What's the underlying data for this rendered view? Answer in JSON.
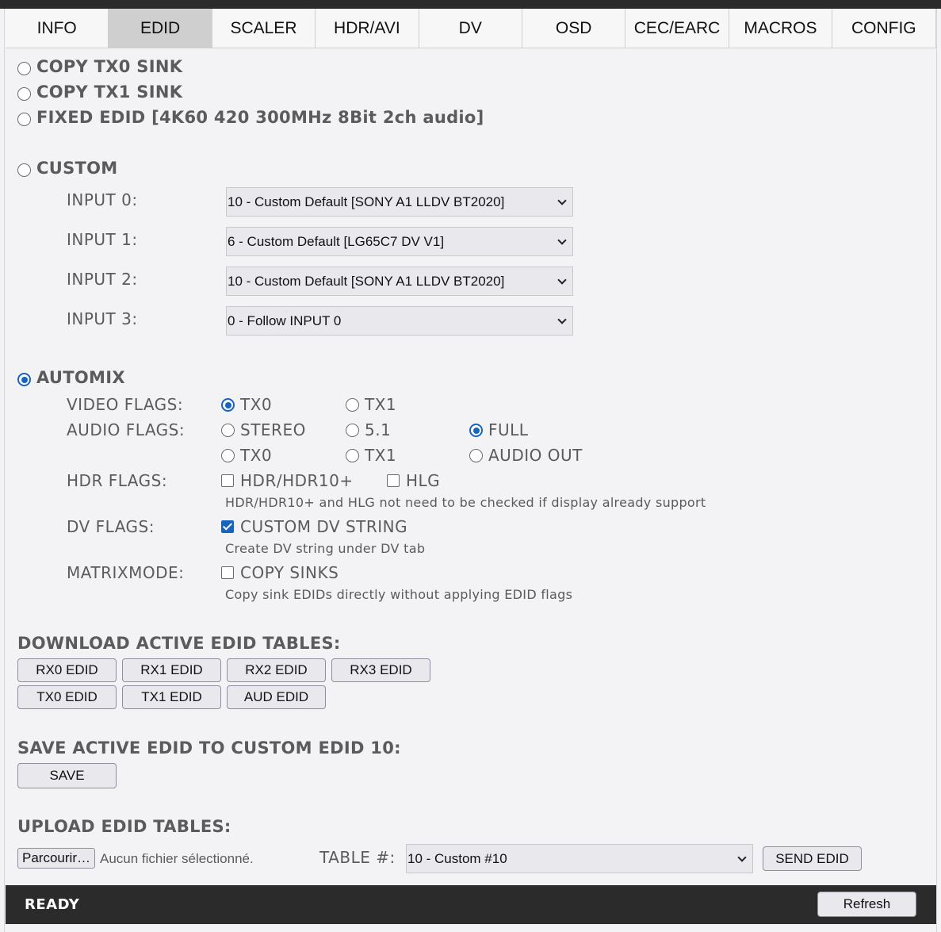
{
  "tabs": [
    "INFO",
    "EDID",
    "SCALER",
    "HDR/AVI",
    "DV",
    "OSD",
    "CEC/EARC",
    "MACROS",
    "CONFIG"
  ],
  "active_tab": "EDID",
  "edid_modes": {
    "copy_tx0": "COPY TX0 SINK",
    "copy_tx1": "COPY TX1 SINK",
    "fixed": "FIXED EDID [4K60 420 300MHz 8Bit 2ch audio]",
    "custom": "CUSTOM",
    "automix": "AUTOMIX",
    "selected": "AUTOMIX"
  },
  "custom_inputs": [
    {
      "label": "INPUT 0:",
      "value": "10 - Custom Default [SONY A1 LLDV BT2020]"
    },
    {
      "label": "INPUT 1:",
      "value": "6 - Custom Default [LG65C7 DV V1]"
    },
    {
      "label": "INPUT 2:",
      "value": "10 - Custom Default [SONY A1 LLDV BT2020]"
    },
    {
      "label": "INPUT 3:",
      "value": "0 - Follow INPUT 0"
    }
  ],
  "automix": {
    "video_flags_label": "VIDEO FLAGS:",
    "video_tx0": "TX0",
    "video_tx1": "TX1",
    "audio_flags_label": "AUDIO FLAGS:",
    "audio_stereo": "STEREO",
    "audio_51": "5.1",
    "audio_full": "FULL",
    "audio_tx0": "TX0",
    "audio_tx1": "TX1",
    "audio_out": "AUDIO OUT",
    "hdr_flags_label": "HDR FLAGS:",
    "hdr_hdr10": "HDR/HDR10+",
    "hdr_hlg": "HLG",
    "hdr_hint": "HDR/HDR10+ and HLG not need to be checked if display already support",
    "dv_flags_label": "DV FLAGS:",
    "dv_custom": "CUSTOM DV STRING",
    "dv_hint": "Create DV string under DV tab",
    "matrix_label": "MATRIXMODE:",
    "matrix_copy": "COPY SINKS",
    "matrix_hint": "Copy sink EDIDs directly without applying EDID flags"
  },
  "download": {
    "title": "DOWNLOAD ACTIVE EDID TABLES:",
    "buttons": [
      "RX0 EDID",
      "RX1 EDID",
      "RX2 EDID",
      "RX3 EDID",
      "TX0 EDID",
      "TX1 EDID",
      "AUD EDID"
    ]
  },
  "save": {
    "title": "SAVE ACTIVE EDID TO CUSTOM EDID 10:",
    "button": "SAVE"
  },
  "upload": {
    "title": "UPLOAD EDID TABLES:",
    "browse": "Parcourir…",
    "no_file": "Aucun fichier sélectionné.",
    "table_label": "TABLE #:",
    "table_value": "10 - Custom #10",
    "send": "SEND EDID"
  },
  "footer": {
    "status": "READY",
    "refresh": "Refresh"
  },
  "colors": {
    "accent": "#1565c0",
    "footer_bg": "#2b2b2b",
    "page_bg": "#f3f2f5",
    "active_tab_bg": "#cfcfcf"
  }
}
